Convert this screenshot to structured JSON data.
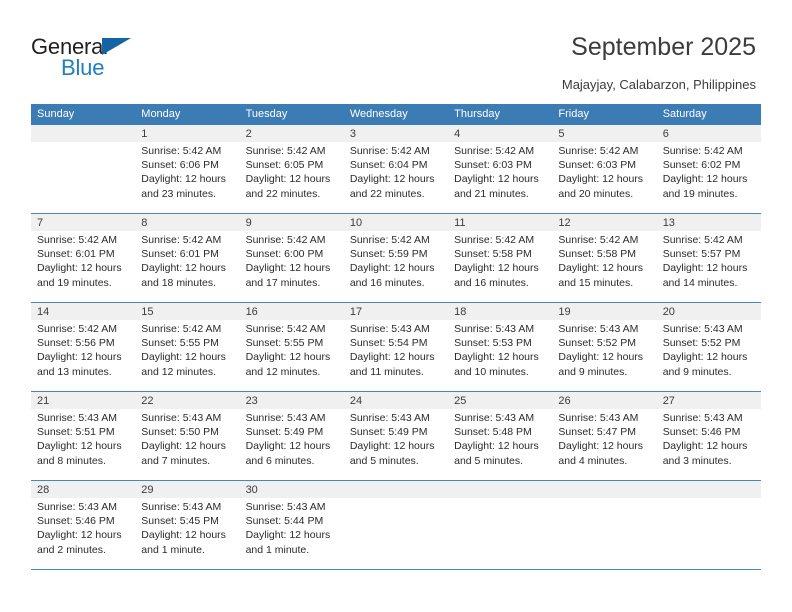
{
  "brand": {
    "name_part1": "General",
    "name_part2": "Blue",
    "triangle_color": "#1464a5",
    "blue_color": "#1f7fc4"
  },
  "header": {
    "title": "September 2025",
    "subtitle": "Majayjay, Calabarzon, Philippines"
  },
  "calendar": {
    "header_color": "#3c7cb5",
    "daynum_row_color": "#f0f0f0",
    "weekday_labels": [
      "Sunday",
      "Monday",
      "Tuesday",
      "Wednesday",
      "Thursday",
      "Friday",
      "Saturday"
    ],
    "weeks": [
      [
        {
          "day": "",
          "lines": []
        },
        {
          "day": "1",
          "lines": [
            "Sunrise: 5:42 AM",
            "Sunset: 6:06 PM",
            "Daylight: 12 hours",
            "and 23 minutes."
          ]
        },
        {
          "day": "2",
          "lines": [
            "Sunrise: 5:42 AM",
            "Sunset: 6:05 PM",
            "Daylight: 12 hours",
            "and 22 minutes."
          ]
        },
        {
          "day": "3",
          "lines": [
            "Sunrise: 5:42 AM",
            "Sunset: 6:04 PM",
            "Daylight: 12 hours",
            "and 22 minutes."
          ]
        },
        {
          "day": "4",
          "lines": [
            "Sunrise: 5:42 AM",
            "Sunset: 6:03 PM",
            "Daylight: 12 hours",
            "and 21 minutes."
          ]
        },
        {
          "day": "5",
          "lines": [
            "Sunrise: 5:42 AM",
            "Sunset: 6:03 PM",
            "Daylight: 12 hours",
            "and 20 minutes."
          ]
        },
        {
          "day": "6",
          "lines": [
            "Sunrise: 5:42 AM",
            "Sunset: 6:02 PM",
            "Daylight: 12 hours",
            "and 19 minutes."
          ]
        }
      ],
      [
        {
          "day": "7",
          "lines": [
            "Sunrise: 5:42 AM",
            "Sunset: 6:01 PM",
            "Daylight: 12 hours",
            "and 19 minutes."
          ]
        },
        {
          "day": "8",
          "lines": [
            "Sunrise: 5:42 AM",
            "Sunset: 6:01 PM",
            "Daylight: 12 hours",
            "and 18 minutes."
          ]
        },
        {
          "day": "9",
          "lines": [
            "Sunrise: 5:42 AM",
            "Sunset: 6:00 PM",
            "Daylight: 12 hours",
            "and 17 minutes."
          ]
        },
        {
          "day": "10",
          "lines": [
            "Sunrise: 5:42 AM",
            "Sunset: 5:59 PM",
            "Daylight: 12 hours",
            "and 16 minutes."
          ]
        },
        {
          "day": "11",
          "lines": [
            "Sunrise: 5:42 AM",
            "Sunset: 5:58 PM",
            "Daylight: 12 hours",
            "and 16 minutes."
          ]
        },
        {
          "day": "12",
          "lines": [
            "Sunrise: 5:42 AM",
            "Sunset: 5:58 PM",
            "Daylight: 12 hours",
            "and 15 minutes."
          ]
        },
        {
          "day": "13",
          "lines": [
            "Sunrise: 5:42 AM",
            "Sunset: 5:57 PM",
            "Daylight: 12 hours",
            "and 14 minutes."
          ]
        }
      ],
      [
        {
          "day": "14",
          "lines": [
            "Sunrise: 5:42 AM",
            "Sunset: 5:56 PM",
            "Daylight: 12 hours",
            "and 13 minutes."
          ]
        },
        {
          "day": "15",
          "lines": [
            "Sunrise: 5:42 AM",
            "Sunset: 5:55 PM",
            "Daylight: 12 hours",
            "and 12 minutes."
          ]
        },
        {
          "day": "16",
          "lines": [
            "Sunrise: 5:42 AM",
            "Sunset: 5:55 PM",
            "Daylight: 12 hours",
            "and 12 minutes."
          ]
        },
        {
          "day": "17",
          "lines": [
            "Sunrise: 5:43 AM",
            "Sunset: 5:54 PM",
            "Daylight: 12 hours",
            "and 11 minutes."
          ]
        },
        {
          "day": "18",
          "lines": [
            "Sunrise: 5:43 AM",
            "Sunset: 5:53 PM",
            "Daylight: 12 hours",
            "and 10 minutes."
          ]
        },
        {
          "day": "19",
          "lines": [
            "Sunrise: 5:43 AM",
            "Sunset: 5:52 PM",
            "Daylight: 12 hours",
            "and 9 minutes."
          ]
        },
        {
          "day": "20",
          "lines": [
            "Sunrise: 5:43 AM",
            "Sunset: 5:52 PM",
            "Daylight: 12 hours",
            "and 9 minutes."
          ]
        }
      ],
      [
        {
          "day": "21",
          "lines": [
            "Sunrise: 5:43 AM",
            "Sunset: 5:51 PM",
            "Daylight: 12 hours",
            "and 8 minutes."
          ]
        },
        {
          "day": "22",
          "lines": [
            "Sunrise: 5:43 AM",
            "Sunset: 5:50 PM",
            "Daylight: 12 hours",
            "and 7 minutes."
          ]
        },
        {
          "day": "23",
          "lines": [
            "Sunrise: 5:43 AM",
            "Sunset: 5:49 PM",
            "Daylight: 12 hours",
            "and 6 minutes."
          ]
        },
        {
          "day": "24",
          "lines": [
            "Sunrise: 5:43 AM",
            "Sunset: 5:49 PM",
            "Daylight: 12 hours",
            "and 5 minutes."
          ]
        },
        {
          "day": "25",
          "lines": [
            "Sunrise: 5:43 AM",
            "Sunset: 5:48 PM",
            "Daylight: 12 hours",
            "and 5 minutes."
          ]
        },
        {
          "day": "26",
          "lines": [
            "Sunrise: 5:43 AM",
            "Sunset: 5:47 PM",
            "Daylight: 12 hours",
            "and 4 minutes."
          ]
        },
        {
          "day": "27",
          "lines": [
            "Sunrise: 5:43 AM",
            "Sunset: 5:46 PM",
            "Daylight: 12 hours",
            "and 3 minutes."
          ]
        }
      ],
      [
        {
          "day": "28",
          "lines": [
            "Sunrise: 5:43 AM",
            "Sunset: 5:46 PM",
            "Daylight: 12 hours",
            "and 2 minutes."
          ]
        },
        {
          "day": "29",
          "lines": [
            "Sunrise: 5:43 AM",
            "Sunset: 5:45 PM",
            "Daylight: 12 hours",
            "and 1 minute."
          ]
        },
        {
          "day": "30",
          "lines": [
            "Sunrise: 5:43 AM",
            "Sunset: 5:44 PM",
            "Daylight: 12 hours",
            "and 1 minute."
          ]
        },
        {
          "day": "",
          "lines": []
        },
        {
          "day": "",
          "lines": []
        },
        {
          "day": "",
          "lines": []
        },
        {
          "day": "",
          "lines": []
        }
      ]
    ]
  }
}
